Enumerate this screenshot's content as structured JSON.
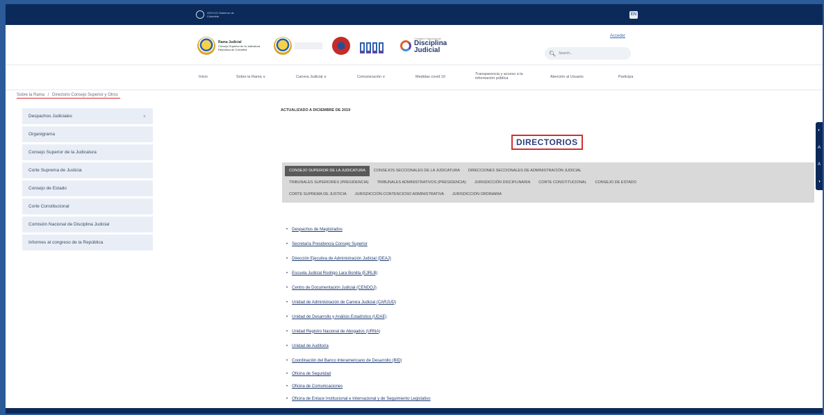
{
  "topbar": {
    "gov_logo_text": "GOV.CO Gobierno de Colombia",
    "button_label": "EN"
  },
  "header": {
    "logos": {
      "rama_judicial": [
        "Rama Judicial",
        "Consejo Superior de la Judicatura",
        "República de Colombia"
      ],
      "dj_title": [
        "Disciplina",
        "Judicial"
      ],
      "dj_sub": "Comisión Nacional de"
    },
    "acceder": "Acceder",
    "search": {
      "placeholder": "Search..."
    }
  },
  "nav": {
    "items": [
      "Inicio",
      "Sobre la Rama ∨",
      "Carrera Judicial ∨",
      "Comunicación ∨",
      "Medidas covid 19",
      "Transparencia y acceso a la información pública",
      "Atención al Usuario",
      "Participa"
    ]
  },
  "breadcrumb": [
    "Sobre la Rama",
    "/",
    "Directorio Consejo Superior y Otros"
  ],
  "sidebar": {
    "items": [
      "Despachos Judiciales",
      "Organigrama",
      "Consejo Superior de la Judicatura",
      "Corte Suprema de Justicia",
      "Consejo de Estado",
      "Corte Constitucional",
      "Comisión Nacional de Disciplina Judicial",
      "Informes al congreso de la República"
    ]
  },
  "main": {
    "updated": "ACTUALIZADO A DICIEMBRE DE 2019",
    "title": "DIRECTORIOS",
    "tabs": [
      [
        "Consejo Superior de la Judicatura",
        "Consejos Seccionales de la Judicatura",
        "Direcciones Seccionales de Administración Judicial"
      ],
      [
        "Tribunales Superiores (Presidencia)",
        "Tribunales Administrativos (Presidencia)",
        "Jurisdicción Disciplinaria",
        "Corte Constitucional",
        "Consejo de Estado"
      ],
      [
        "Corte Suprema de Justicia",
        "Jurisdicción Contencioso Administrativa",
        "Jurisdicción Ordinaria"
      ]
    ],
    "links": [
      "Despachos de Magistrados",
      "Secretaría Presidencia Consejo Superior",
      "Dirección Ejecutiva de Administración Judicial (DEAJ)",
      "Escuela Judicial Rodrigo Lara Bonilla (EJRLB)",
      "Centro de Documentación Judicial (CENDOJ)",
      "Unidad de Administración de Carrera Judicial (CARJUD)",
      "Unidad de Desarrollo y Análisis Estadístico (UDAE)",
      "Unidad Registro Nacional de Abogados (URNA)",
      "Unidad de Auditoría",
      "Coordinación del Banco Interamericano de Desarrollo (BID)",
      "Oficina de Seguridad",
      "Oficina de Comunicaciones",
      "Oficina de Enlace Institucional e Internacional y de Seguimiento Legislativo"
    ]
  },
  "tools": [
    "◐",
    "A",
    "A",
    "◑"
  ]
}
